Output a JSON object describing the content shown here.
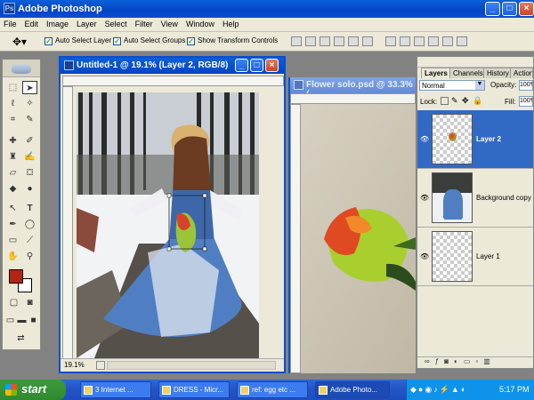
{
  "app": {
    "title": "Adobe Photoshop",
    "window_controls": {
      "minimize": "_",
      "maximize": "□",
      "close": "×"
    }
  },
  "menubar": [
    "File",
    "Edit",
    "Image",
    "Layer",
    "Select",
    "Filter",
    "View",
    "Window",
    "Help"
  ],
  "options": {
    "auto_select_layer": "Auto Select Layer",
    "auto_select_groups": "Auto Select Groups",
    "show_transform_controls": "Show Transform Controls"
  },
  "documents": [
    {
      "title": "Untitled-1 @ 19.1% (Layer 2, RGB/8)",
      "zoom": "19.1%"
    },
    {
      "title": "Flower solo.psd @ 33.3% (..."
    }
  ],
  "layers_panel": {
    "tabs": [
      "Layers",
      "Channels",
      "History",
      "Actions"
    ],
    "blend_mode": "Normal",
    "opacity_label": "Opacity:",
    "opacity_value": "100%",
    "lock_label": "Lock:",
    "fill_label": "Fill:",
    "fill_value": "100%",
    "layers": [
      {
        "name": "Layer 2",
        "selected": true
      },
      {
        "name": "Background copy",
        "selected": false
      },
      {
        "name": "Layer 1",
        "selected": false
      }
    ]
  },
  "taskbar": {
    "start": "start",
    "tasks": [
      {
        "label": "3 Internet ...",
        "active": false
      },
      {
        "label": "DRESS - Micr...",
        "active": false
      },
      {
        "label": "ref: egg etc ...",
        "active": false
      },
      {
        "label": "Adobe Photo...",
        "active": true
      }
    ],
    "clock": "5:17 PM"
  },
  "colors": {
    "titlebar": "#0a5fd8",
    "selected_layer": "#316ac5",
    "foreground_swatch": "#b22414",
    "background_swatch": "#ffffff"
  }
}
